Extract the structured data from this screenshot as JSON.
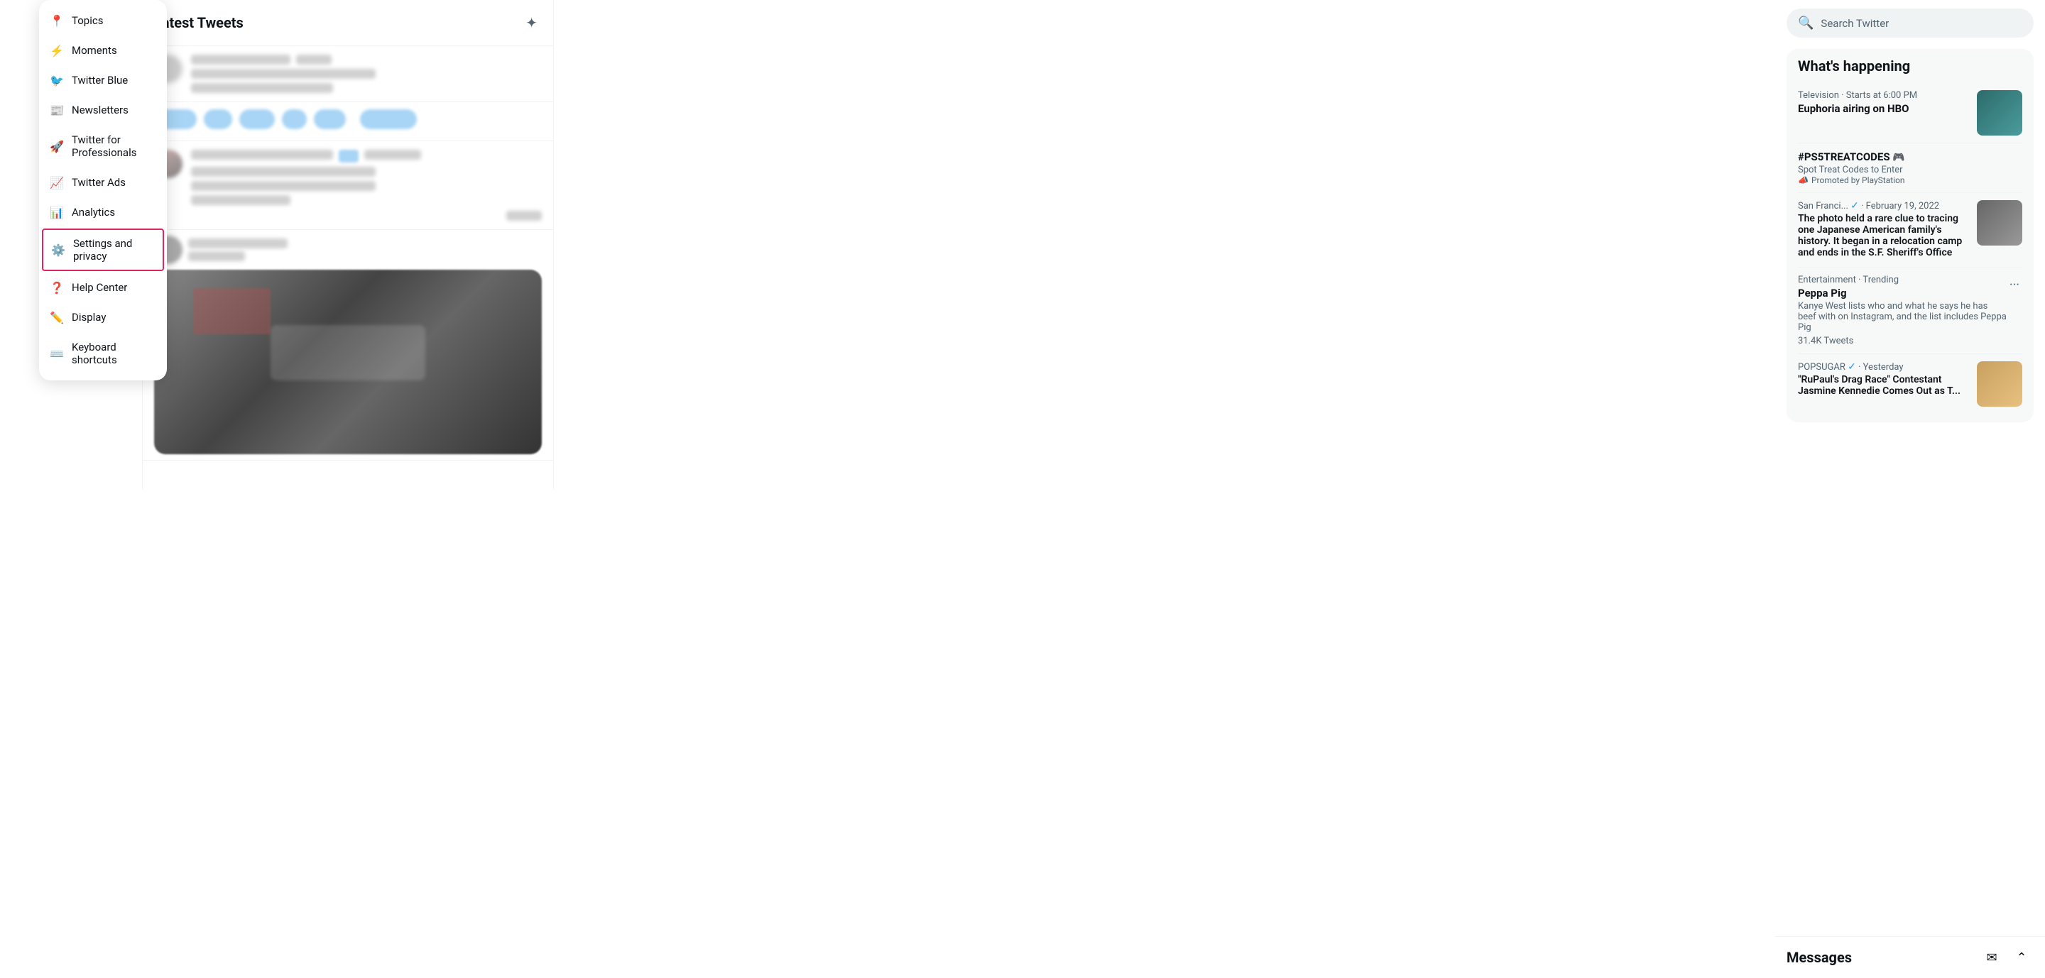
{
  "menu": {
    "items": [
      {
        "id": "topics",
        "label": "Topics",
        "icon": "📍"
      },
      {
        "id": "moments",
        "label": "Moments",
        "icon": "⚡"
      },
      {
        "id": "twitter-blue",
        "label": "Twitter Blue",
        "icon": "🐦",
        "blue": true
      },
      {
        "id": "newsletters",
        "label": "Newsletters",
        "icon": "📰"
      },
      {
        "id": "professionals",
        "label": "Twitter for Professionals",
        "icon": "🚀"
      },
      {
        "id": "twitter-ads",
        "label": "Twitter Ads",
        "icon": "📈"
      },
      {
        "id": "analytics",
        "label": "Analytics",
        "icon": "📊"
      },
      {
        "id": "settings",
        "label": "Settings and privacy",
        "icon": "⚙️",
        "highlighted": true
      },
      {
        "id": "help",
        "label": "Help Center",
        "icon": "❓"
      },
      {
        "id": "display",
        "label": "Display",
        "icon": "✏️"
      },
      {
        "id": "keyboard",
        "label": "Keyboard shortcuts",
        "icon": "⌨️"
      }
    ]
  },
  "feed": {
    "title": "Latest Tweets",
    "sparkle_label": "✦"
  },
  "search": {
    "placeholder": "Search Twitter"
  },
  "whats_happening": {
    "title": "What's happening",
    "trends": [
      {
        "id": "euphoria",
        "category": "Television · Starts at 6:00 PM",
        "name": "Euphoria airing on HBO",
        "has_image": true,
        "image_class": "person1"
      },
      {
        "id": "ps5",
        "category": "",
        "name": "#PS5TREATCODES 🎮",
        "sub": "Spot Treat Codes to Enter",
        "promoted": "Promoted by PlayStation",
        "has_image": false
      },
      {
        "id": "san-francisco",
        "category": "San Franci... ✓ · February 19, 2022",
        "name": "The photo held a rare clue to tracing one Japanese American family's history. It began in a relocation camp and ends in the S.F. Sheriff's Office",
        "has_image": true,
        "image_class": "person2",
        "is_article": true
      },
      {
        "id": "peppa-pig",
        "category": "Entertainment · Trending",
        "name": "Peppa Pig",
        "sub": "Kanye West lists who and what he says he has beef with on Instagram, and the list includes Peppa Pig",
        "tweet_count": "31.4K Tweets",
        "has_dots": true
      },
      {
        "id": "popsugar",
        "category": "POPSUGAR ✓ · Yesterday",
        "name": "\"RuPaul's Drag Race\" Contestant Jasmine Kennedie Comes Out as T...",
        "has_image": true,
        "image_class": "person3"
      }
    ]
  },
  "messages": {
    "title": "Messages",
    "compose_icon": "✉",
    "chevron_icon": "⌃"
  }
}
